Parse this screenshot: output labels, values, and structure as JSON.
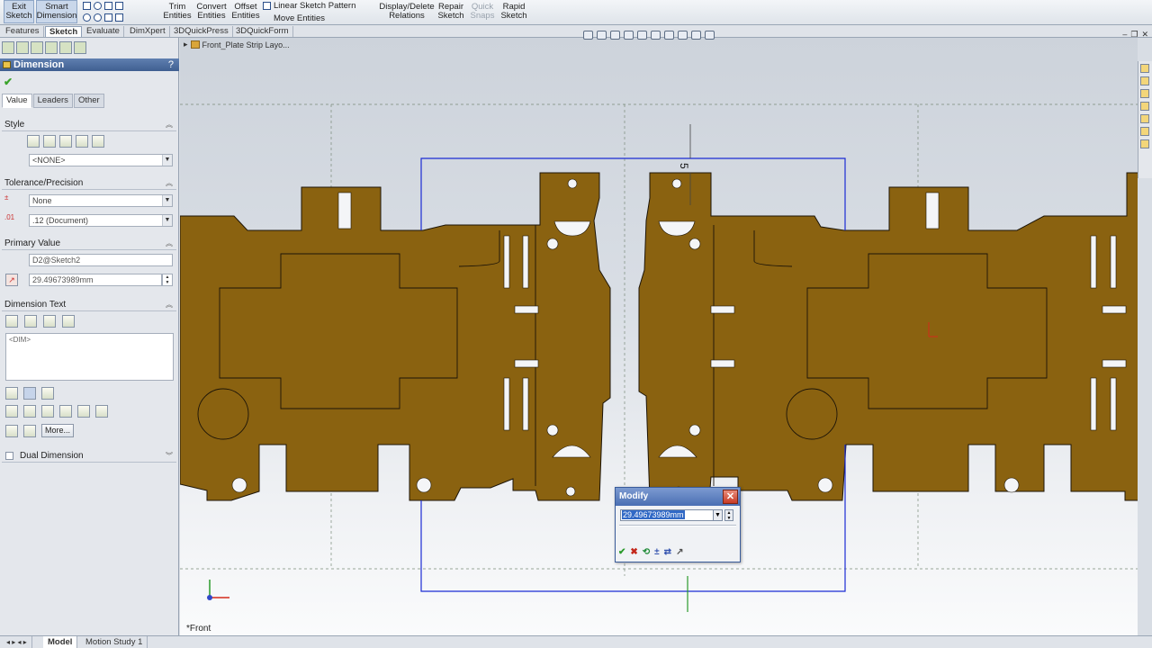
{
  "ribbon": {
    "exit_sketch": [
      "Exit",
      "Sketch"
    ],
    "smart_dimension": [
      "Smart",
      "Dimension"
    ],
    "trim_entities": [
      "Trim",
      "Entities"
    ],
    "convert_entities": [
      "Convert",
      "Entities"
    ],
    "offset_entities": [
      "Offset",
      "Entities"
    ],
    "linear_sketch_pattern": "Linear Sketch Pattern",
    "move_entities": "Move Entities",
    "display_delete_relations": [
      "Display/Delete",
      "Relations"
    ],
    "repair_sketch": [
      "Repair",
      "Sketch"
    ],
    "quick_snaps": [
      "Quick",
      "Snaps"
    ],
    "rapid_sketch": [
      "Rapid",
      "Sketch"
    ]
  },
  "command_tabs": [
    "Features",
    "Sketch",
    "Evaluate",
    "DimXpert",
    "3DQuickPress",
    "3DQuickForm"
  ],
  "active_command_tab": "Sketch",
  "property_manager": {
    "title": "Dimension",
    "help": "?",
    "tabs": [
      "Value",
      "Leaders",
      "Other"
    ],
    "style_label": "Style",
    "style_value": "<NONE>",
    "tolerance_label": "Tolerance/Precision",
    "tolerance_value": "None",
    "precision_value": ".12 (Document)",
    "primary_value_label": "Primary Value",
    "primary_name": "D2@Sketch2",
    "primary_value": "29.49673989mm",
    "dimension_text_label": "Dimension Text",
    "dimension_text": "<DIM>",
    "more_button": "More...",
    "dual_dimension_label": "Dual Dimension"
  },
  "graphics": {
    "tree_flyout": "Front_Plate Strip Layo...",
    "view_name": "*Front",
    "dimension_text": "5"
  },
  "modify_dialog": {
    "title": "Modify",
    "value": "29.49673989mm"
  },
  "bottom_tabs": [
    "Model",
    "Motion Study 1"
  ],
  "colors": {
    "part_fill": "#8a6210",
    "sketch_line": "#1b2bd4",
    "accent": "#3f5f91"
  }
}
